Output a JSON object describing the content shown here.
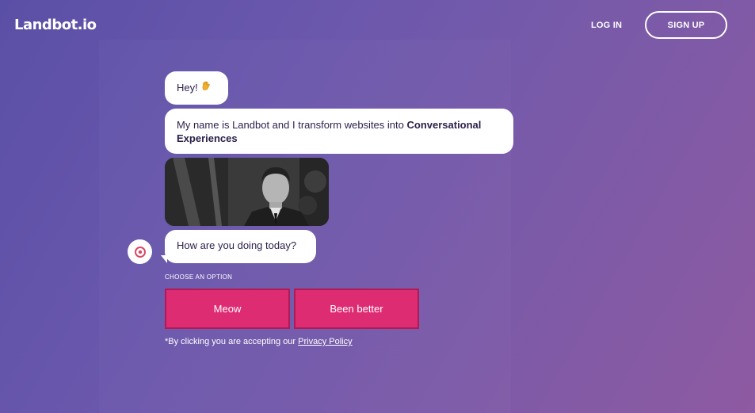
{
  "header": {
    "logo": "Landbot.io",
    "login_label": "LOG IN",
    "signup_label": "SIGN UP"
  },
  "chat": {
    "greeting": "Hey!",
    "greeting_icon": "waving-hand-icon",
    "intro_text": "My name is Landbot and I transform websites into ",
    "intro_bold": "Conversational Experiences",
    "question": "How are you doing today?",
    "choose_label": "CHOOSE AN OPTION",
    "options": [
      "Meow",
      "Been better"
    ],
    "disclaimer_text": "*By clicking you are accepting our ",
    "privacy_link": "Privacy Policy"
  },
  "colors": {
    "option_bg": "#dd2c72",
    "option_border": "#b01a57",
    "bg_start": "#5a4fa6",
    "bg_end": "#8e5aa2"
  }
}
